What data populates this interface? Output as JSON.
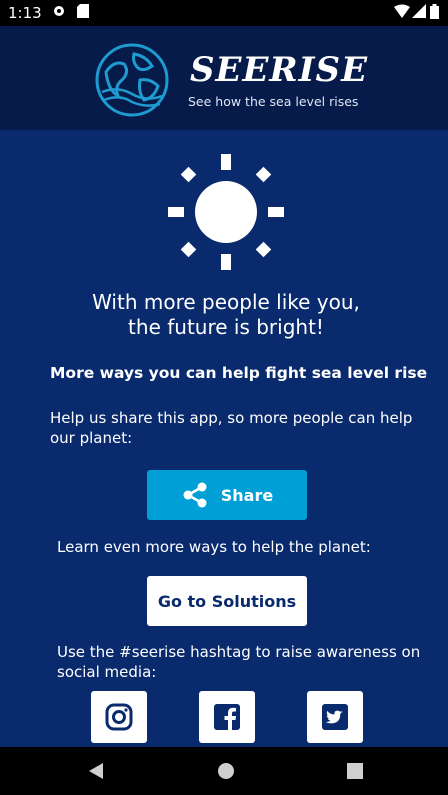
{
  "status_bar": {
    "time": "1:13"
  },
  "header": {
    "brand": "SEERISE",
    "tagline": "See how the sea level rises"
  },
  "main": {
    "headline_line1": "With more people like you,",
    "headline_line2": "the future is bright!",
    "subheading": "More ways you can help fight sea level rise",
    "share_text": "Help us share this app, so more people can help our planet:",
    "share_button": "Share",
    "learn_text": "Learn even more ways to help the planet:",
    "solutions_button": "Go to Solutions",
    "hashtag_text": "Use the #seerise hashtag to raise awareness on social media:"
  },
  "social": [
    "instagram-icon",
    "facebook-icon",
    "twitter-icon"
  ],
  "colors": {
    "background": "#0a2a6e",
    "header": "#061b4a",
    "share_button": "#00a0d6",
    "globe": "#1e9bd0"
  }
}
